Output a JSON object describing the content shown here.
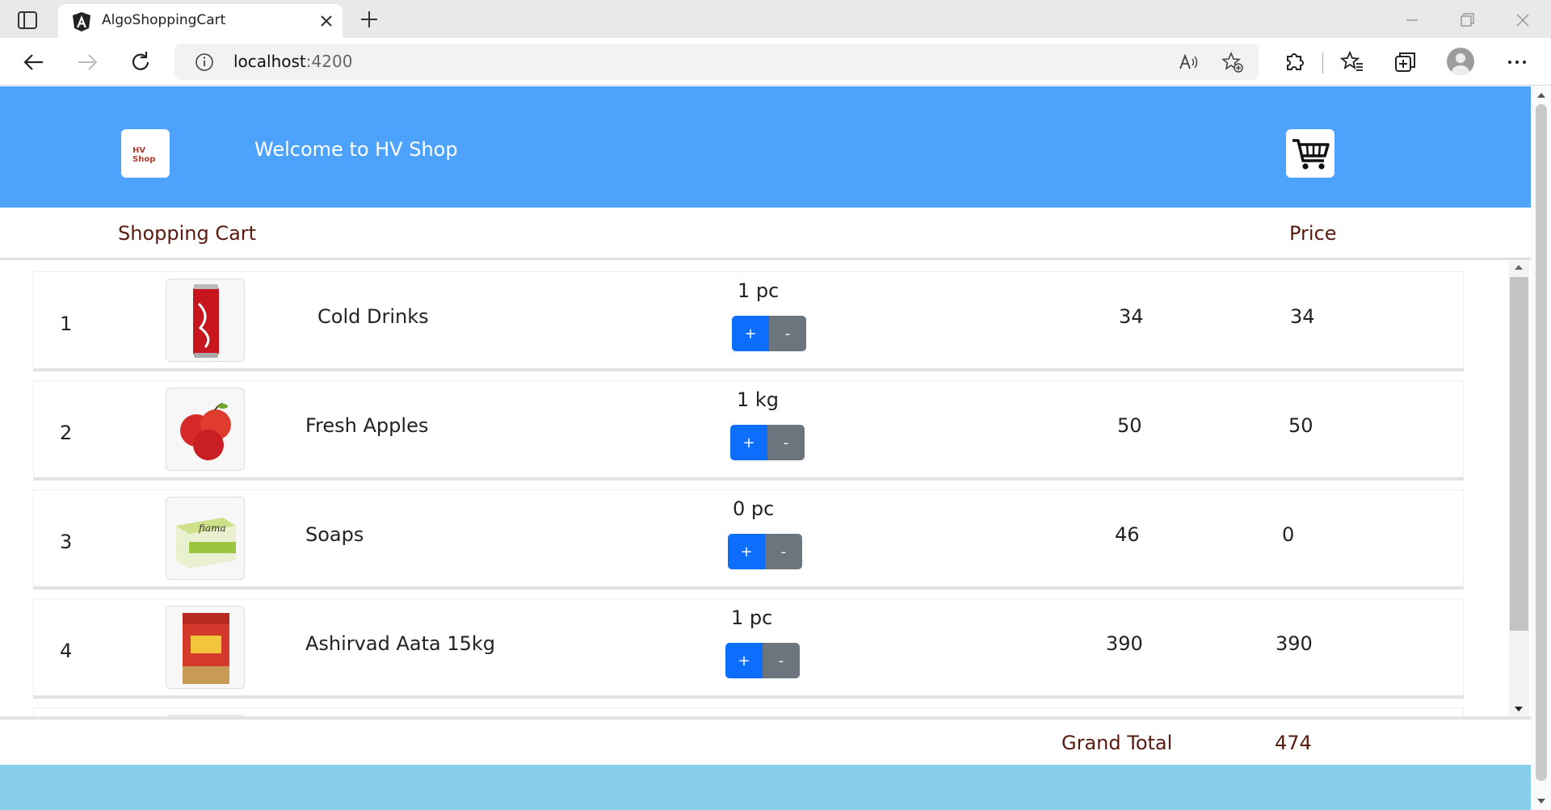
{
  "browser": {
    "tab_title": "AlgoShoppingCart",
    "url_host": "localhost",
    "url_port": ":4200"
  },
  "header": {
    "logo_text": "HV Shop",
    "welcome": "Welcome to HV Shop",
    "bg_color": "#4da2fc"
  },
  "cart": {
    "col_title": "Shopping Cart",
    "col_price": "Price",
    "items": [
      {
        "num": "1",
        "name": "Cold Drinks",
        "qty": "1 pc",
        "unit_price": "34",
        "price": "34",
        "thumb": "cola-can-image"
      },
      {
        "num": "2",
        "name": "Fresh Apples",
        "qty": "1 kg",
        "unit_price": "50",
        "price": "50",
        "thumb": "apples-image"
      },
      {
        "num": "3",
        "name": "Soaps",
        "qty": "0 pc",
        "unit_price": "46",
        "price": "0",
        "thumb": "soap-box-image"
      },
      {
        "num": "4",
        "name": "Ashirvad Aata 15kg",
        "qty": "1 pc",
        "unit_price": "390",
        "price": "390",
        "thumb": "aata-bag-image"
      }
    ],
    "plus_label": "+",
    "minus_label": "-",
    "grand_total_label": "Grand Total",
    "grand_total_value": "474"
  }
}
